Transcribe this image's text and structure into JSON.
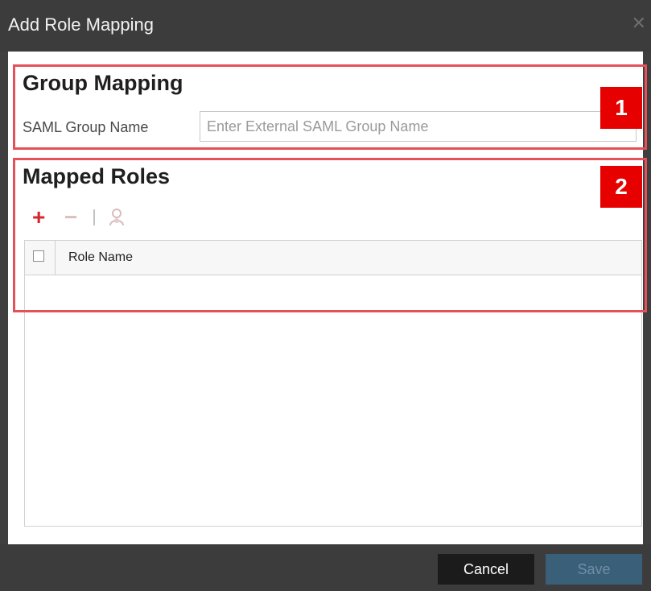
{
  "dialog": {
    "title": "Add Role Mapping",
    "close_icon": "close-icon"
  },
  "group_mapping": {
    "title": "Group Mapping",
    "callout_number": "1",
    "saml_group_label": "SAML Group Name",
    "saml_group_placeholder": "Enter External SAML Group Name",
    "saml_group_value": ""
  },
  "mapped_roles": {
    "title": "Mapped Roles",
    "callout_number": "2",
    "toolbar": {
      "add_icon": "add-icon",
      "remove_icon": "remove-icon",
      "role_icon": "role-icon"
    },
    "columns": [
      "Role Name"
    ],
    "rows": []
  },
  "footer": {
    "cancel_label": "Cancel",
    "save_label": "Save"
  },
  "colors": {
    "callout_border": "#e45159",
    "callout_badge": "#e60000",
    "titlebar": "#3c3c3c",
    "add_icon": "#d5282d",
    "save_button": "#3a5f78",
    "cancel_button": "#1b1b1b"
  }
}
